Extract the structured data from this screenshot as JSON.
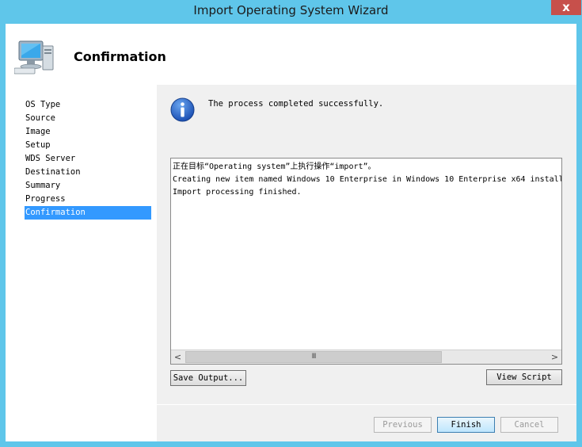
{
  "window": {
    "title": "Import Operating System Wizard",
    "close_glyph": "x"
  },
  "header": {
    "title": "Confirmation",
    "icon": "computer-icon"
  },
  "nav": {
    "items": [
      {
        "label": "OS Type"
      },
      {
        "label": "Source"
      },
      {
        "label": "Image"
      },
      {
        "label": "Setup"
      },
      {
        "label": "WDS Server"
      },
      {
        "label": "Destination"
      },
      {
        "label": "Summary"
      },
      {
        "label": "Progress"
      },
      {
        "label": "Confirmation"
      }
    ],
    "active": "Confirmation"
  },
  "content": {
    "status_icon": "info-icon",
    "status_message": "The process completed successfully.",
    "output_lines": [
      "正在目标“Operating system”上执行操作“import”。",
      "Creating new item named Windows 10 Enterprise in Windows 10 Enterprise x64 install",
      "Import processing finished."
    ],
    "scroll_left": "<",
    "scroll_right": ">",
    "scroll_grip": "III"
  },
  "buttons": {
    "save_output": "Save Output...",
    "view_script": "View Script",
    "previous": "Previous",
    "finish": "Finish",
    "cancel": "Cancel"
  },
  "colors": {
    "titlebar": "#5fc6ea",
    "close": "#c7504b",
    "selection": "#3399ff"
  }
}
